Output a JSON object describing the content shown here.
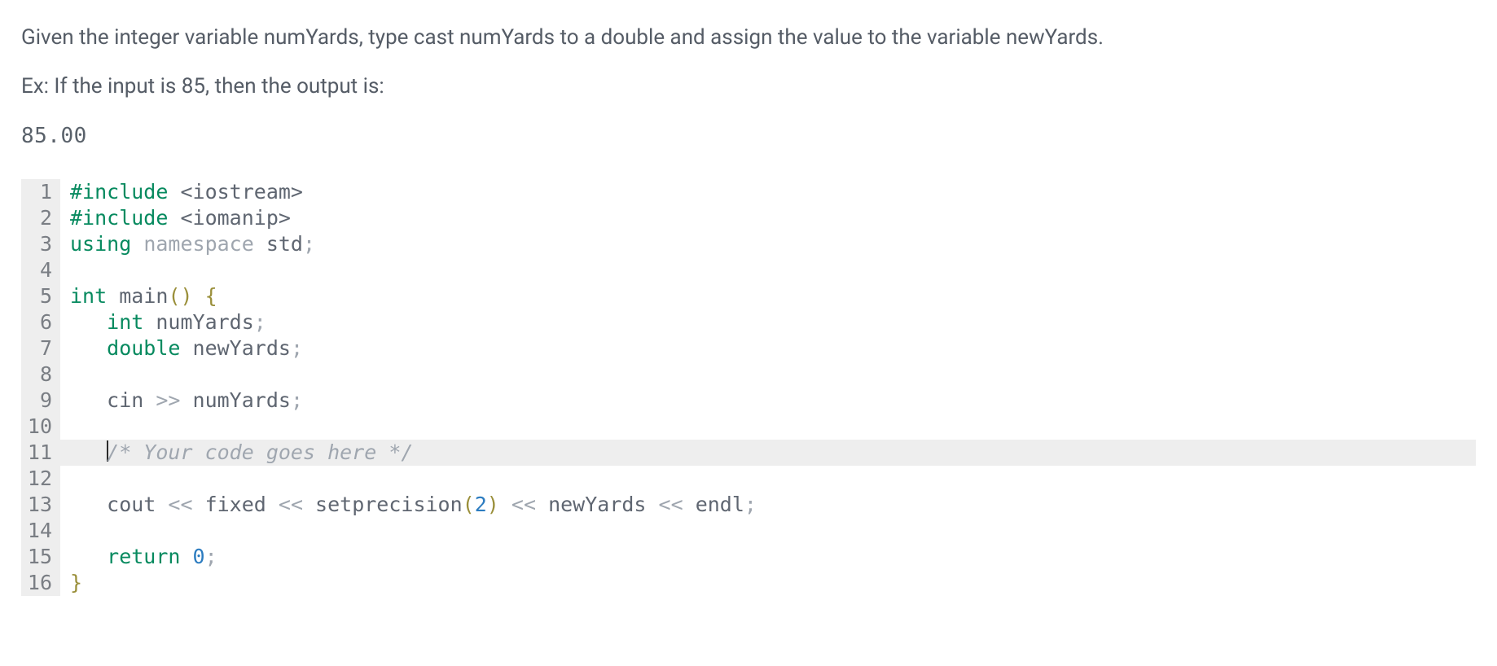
{
  "prompt": {
    "question": "Given the integer variable numYards, type cast numYards to a double and assign the value to the variable newYards.",
    "example_heading": "Ex: If the input is 85, then the output is:",
    "example_output": "85.00"
  },
  "editor": {
    "active_line": 11,
    "lines": [
      {
        "n": 1,
        "tokens": [
          {
            "cls": "tok-preproc",
            "t": "#include "
          },
          {
            "cls": "tok-angle",
            "t": "<iostream>"
          }
        ]
      },
      {
        "n": 2,
        "tokens": [
          {
            "cls": "tok-preproc",
            "t": "#include "
          },
          {
            "cls": "tok-angle",
            "t": "<iomanip>"
          }
        ]
      },
      {
        "n": 3,
        "tokens": [
          {
            "cls": "tok-keyword",
            "t": "using "
          },
          {
            "cls": "tok-namespace",
            "t": "namespace "
          },
          {
            "cls": "tok-ident",
            "t": "std"
          },
          {
            "cls": "tok-semicolon",
            "t": ";"
          }
        ]
      },
      {
        "n": 4,
        "tokens": []
      },
      {
        "n": 5,
        "tokens": [
          {
            "cls": "tok-type",
            "t": "int "
          },
          {
            "cls": "tok-ident",
            "t": "main"
          },
          {
            "cls": "tok-paren",
            "t": "()"
          },
          {
            "cls": "",
            "t": " "
          },
          {
            "cls": "tok-brace",
            "t": "{"
          }
        ]
      },
      {
        "n": 6,
        "tokens": [
          {
            "cls": "",
            "t": "   "
          },
          {
            "cls": "tok-type",
            "t": "int "
          },
          {
            "cls": "tok-ident",
            "t": "numYards"
          },
          {
            "cls": "tok-semicolon",
            "t": ";"
          }
        ]
      },
      {
        "n": 7,
        "tokens": [
          {
            "cls": "",
            "t": "   "
          },
          {
            "cls": "tok-type",
            "t": "double "
          },
          {
            "cls": "tok-ident",
            "t": "newYards"
          },
          {
            "cls": "tok-semicolon",
            "t": ";"
          }
        ]
      },
      {
        "n": 8,
        "tokens": []
      },
      {
        "n": 9,
        "tokens": [
          {
            "cls": "",
            "t": "   "
          },
          {
            "cls": "tok-ident",
            "t": "cin "
          },
          {
            "cls": "tok-operator",
            "t": ">> "
          },
          {
            "cls": "tok-ident",
            "t": "numYards"
          },
          {
            "cls": "tok-semicolon",
            "t": ";"
          }
        ]
      },
      {
        "n": 10,
        "tokens": []
      },
      {
        "n": 11,
        "active": true,
        "tokens": [
          {
            "cls": "",
            "t": "   "
          },
          {
            "cls": "caret-token",
            "t": ""
          },
          {
            "cls": "tok-comment",
            "t": "/* Your code goes here */"
          }
        ]
      },
      {
        "n": 12,
        "tokens": []
      },
      {
        "n": 13,
        "tokens": [
          {
            "cls": "",
            "t": "   "
          },
          {
            "cls": "tok-ident",
            "t": "cout "
          },
          {
            "cls": "tok-operator",
            "t": "<< "
          },
          {
            "cls": "tok-ident",
            "t": "fixed "
          },
          {
            "cls": "tok-operator",
            "t": "<< "
          },
          {
            "cls": "tok-ident",
            "t": "setprecision"
          },
          {
            "cls": "tok-paren",
            "t": "("
          },
          {
            "cls": "tok-number",
            "t": "2"
          },
          {
            "cls": "tok-paren",
            "t": ")"
          },
          {
            "cls": "",
            "t": " "
          },
          {
            "cls": "tok-operator",
            "t": "<< "
          },
          {
            "cls": "tok-ident",
            "t": "newYards "
          },
          {
            "cls": "tok-operator",
            "t": "<< "
          },
          {
            "cls": "tok-ident",
            "t": "endl"
          },
          {
            "cls": "tok-semicolon",
            "t": ";"
          }
        ]
      },
      {
        "n": 14,
        "tokens": []
      },
      {
        "n": 15,
        "tokens": [
          {
            "cls": "",
            "t": "   "
          },
          {
            "cls": "tok-keyword",
            "t": "return "
          },
          {
            "cls": "tok-number",
            "t": "0"
          },
          {
            "cls": "tok-semicolon",
            "t": ";"
          }
        ]
      },
      {
        "n": 16,
        "tokens": [
          {
            "cls": "tok-brace",
            "t": "}"
          }
        ]
      }
    ]
  }
}
